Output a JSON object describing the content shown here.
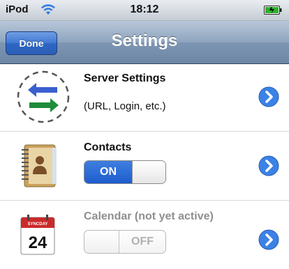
{
  "status_bar": {
    "carrier": "iPod",
    "time": "18:12"
  },
  "nav_bar": {
    "done_label": "Done",
    "title": "Settings"
  },
  "rows": [
    {
      "title": "Server Settings",
      "subtitle": "(URL, Login, etc.)",
      "icon": "server-sync-icon"
    },
    {
      "title": "Contacts",
      "toggle_label": "ON",
      "toggle_state": "on",
      "icon": "address-book-icon"
    },
    {
      "title": "Calendar (not yet active)",
      "toggle_label": "OFF",
      "toggle_state": "off",
      "disabled": true,
      "icon": "calendar-icon",
      "calendar_day": "24",
      "calendar_header": "SYNCDAY"
    }
  ],
  "colors": {
    "accent": "#2e66c4",
    "navbar": "#7d96b3",
    "disclosure": "#3b82e6"
  }
}
